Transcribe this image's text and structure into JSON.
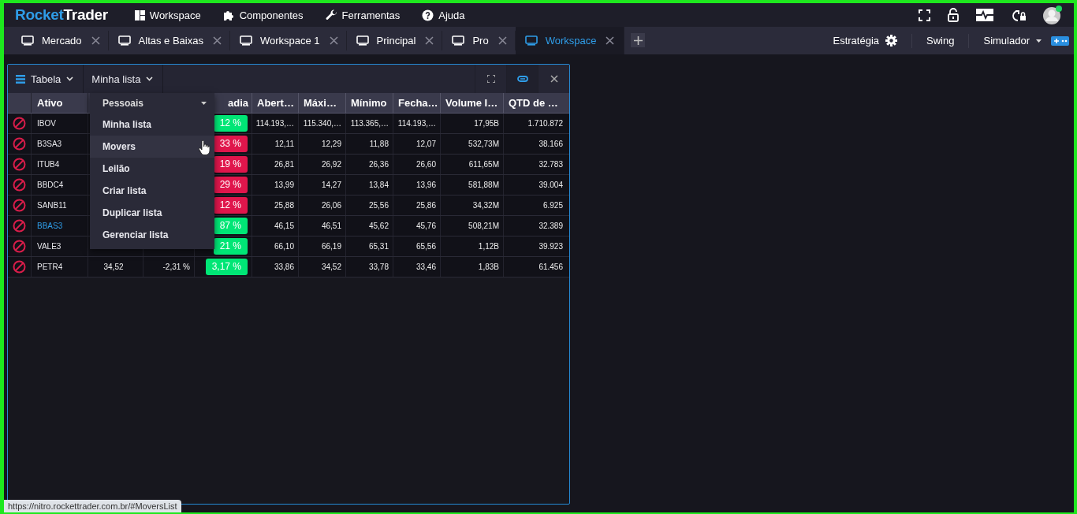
{
  "logo": {
    "first": "Rocket",
    "second": "Trader"
  },
  "menu": [
    {
      "label": "Workspace",
      "kind": "layout"
    },
    {
      "label": "Componentes",
      "kind": "components"
    },
    {
      "label": "Ferramentas",
      "kind": "tools"
    },
    {
      "label": "Ajuda",
      "kind": "help"
    }
  ],
  "tabs": [
    {
      "label": "Mercado",
      "selected": false
    },
    {
      "label": "Altas e Baixas",
      "selected": false
    },
    {
      "label": "Workspace 1",
      "selected": false
    },
    {
      "label": "Principal",
      "selected": false
    },
    {
      "label": "Pro",
      "selected": false
    },
    {
      "label": "Workspace",
      "selected": true
    }
  ],
  "right_controls": [
    {
      "label": "Estratégia",
      "kind": "gear"
    },
    {
      "label": "Swing",
      "kind": "plain"
    },
    {
      "label": "Simulador",
      "kind": "dropdown"
    }
  ],
  "panel": {
    "view": "Tabela",
    "list": "Minha lista",
    "columns": [
      "Ativo",
      "adia",
      "Abert…",
      "Máxi…",
      "Mínimo",
      "Fecha…",
      "Volume I…",
      "QTD de …"
    ],
    "rows": [
      {
        "ticker": "IBOV",
        "highlighted": false,
        "change": "12 %",
        "color": "#00e676",
        "open": "114.193,…",
        "high": "115.340,…",
        "low": "113.365,…",
        "close": "114.193,…",
        "volume": "17,95B",
        "qty": "1.710.872"
      },
      {
        "ticker": "B3SA3",
        "highlighted": false,
        "change": "33 %",
        "color": "#e0164c",
        "open": "12,11",
        "high": "12,29",
        "low": "11,88",
        "close": "12,07",
        "volume": "532,73M",
        "qty": "38.166"
      },
      {
        "ticker": "ITUB4",
        "highlighted": false,
        "change": "19 %",
        "color": "#e0164c",
        "open": "26,81",
        "high": "26,92",
        "low": "26,36",
        "close": "26,60",
        "volume": "611,65M",
        "qty": "32.783"
      },
      {
        "ticker": "BBDC4",
        "highlighted": false,
        "change": "29 %",
        "color": "#e0164c",
        "open": "13,99",
        "high": "14,27",
        "low": "13,84",
        "close": "13,96",
        "volume": "581,88M",
        "qty": "39.004"
      },
      {
        "ticker": "SANB11",
        "highlighted": false,
        "change": "12 %",
        "color": "#e0164c",
        "open": "25,88",
        "high": "26,06",
        "low": "25,56",
        "close": "25,86",
        "volume": "34,32M",
        "qty": "6.925"
      },
      {
        "ticker": "BBAS3",
        "highlighted": true,
        "change": "87 %",
        "color": "#00e676",
        "open": "46,15",
        "high": "46,51",
        "low": "45,62",
        "close": "45,76",
        "volume": "508,21M",
        "qty": "32.389"
      },
      {
        "ticker": "VALE3",
        "highlighted": false,
        "change": "21 %",
        "color": "#00e676",
        "open": "66,10",
        "high": "66,19",
        "low": "65,31",
        "close": "65,56",
        "volume": "1,12B",
        "qty": "39.923"
      },
      {
        "ticker": "PETR4",
        "highlighted": false,
        "last": "34,52",
        "variation": "-2,31 %",
        "change": "3,17 %",
        "color": "#00e676",
        "open": "33,86",
        "high": "34,52",
        "low": "33,78",
        "close": "33,46",
        "volume": "1,83B",
        "qty": "61.456"
      }
    ],
    "dropdown": {
      "header": "Pessoais",
      "items": [
        {
          "label": "Minha lista",
          "hovered": false
        },
        {
          "label": "Movers",
          "hovered": true
        },
        {
          "label": "Leilão",
          "hovered": false
        },
        {
          "label": "Criar lista",
          "hovered": false
        },
        {
          "label": "Duplicar lista",
          "hovered": false
        },
        {
          "label": "Gerenciar lista",
          "hovered": false
        }
      ]
    }
  },
  "status_url": "https://nitro.rockettrader.com.br/#MoversList"
}
